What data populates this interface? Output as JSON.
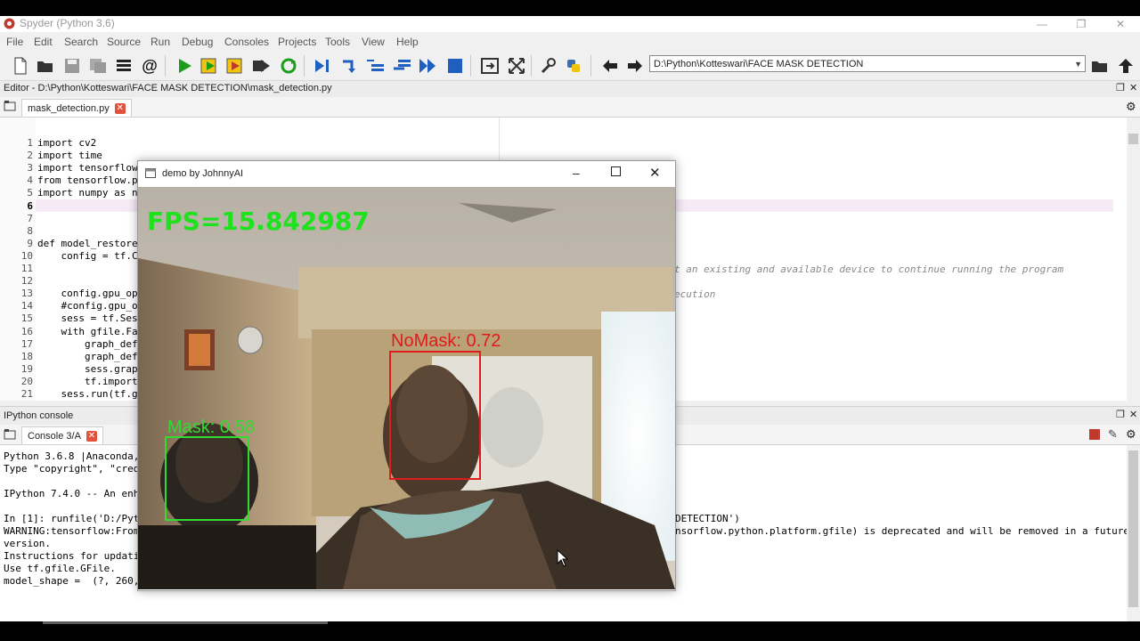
{
  "window": {
    "title": "Spyder (Python 3.6)"
  },
  "menu": [
    "File",
    "Edit",
    "Search",
    "Source",
    "Run",
    "Debug",
    "Consoles",
    "Projects",
    "Tools",
    "View",
    "Help"
  ],
  "toolbar": {
    "path": "D:\\Python\\Kotteswari\\FACE MASK DETECTION"
  },
  "editor": {
    "header": "Editor - D:\\Python\\Kotteswari\\FACE MASK DETECTION\\mask_detection.py",
    "tab": "mask_detection.py",
    "line_numbers": [
      "1",
      "2",
      "3",
      "4",
      "5",
      "6",
      "7",
      "8",
      "9",
      "10",
      "11",
      "12",
      "13",
      "14",
      "15",
      "16",
      "17",
      "18",
      "19",
      "20",
      "21"
    ],
    "lines": [
      "import cv2",
      "import time",
      "import tensorflow",
      "from tensorflow.p",
      "import numpy as n",
      "",
      "",
      "",
      "def model_restore",
      "    config = tf.C",
      "",
      "",
      "    config.gpu_op",
      "    #config.gpu_o",
      "    sess = tf.Ses",
      "    with gfile.Fa",
      "        graph_def",
      "        graph_def",
      "        sess.grap",
      "        tf.import",
      "    sess.run(tf.g"
    ],
    "comment_right_1": "t an existing and available device to continue running the program",
    "comment_right_2": "ecution"
  },
  "ipython": {
    "header": "IPython console",
    "tab": "Console 3/A",
    "lines": [
      "Python 3.6.8 |Anaconda,",
      "Type \"copyright\", \"cred",
      "",
      "IPython 7.4.0 -- An enh",
      "",
      "In [1]: runfile('D:/Pyt",
      "WARNING:tensorflow:From",
      "version.",
      "Instructions for updati",
      "Use tf.gfile.GFile.",
      "model_shape =  (?, 260,"
    ],
    "right_1": "DETECTION')",
    "right_2": "nsorflow.python.platform.gfile) is deprecated and will be removed in a future"
  },
  "demo": {
    "title": "demo by JohnnyAI",
    "fps": "FPS=15.842987",
    "nomask_label": "NoMask: 0.72",
    "mask_label": "Mask: 0.58",
    "colors": {
      "fps": "#1fe21f",
      "nomask": "#e01b1b",
      "mask": "#2fdc2f"
    }
  }
}
